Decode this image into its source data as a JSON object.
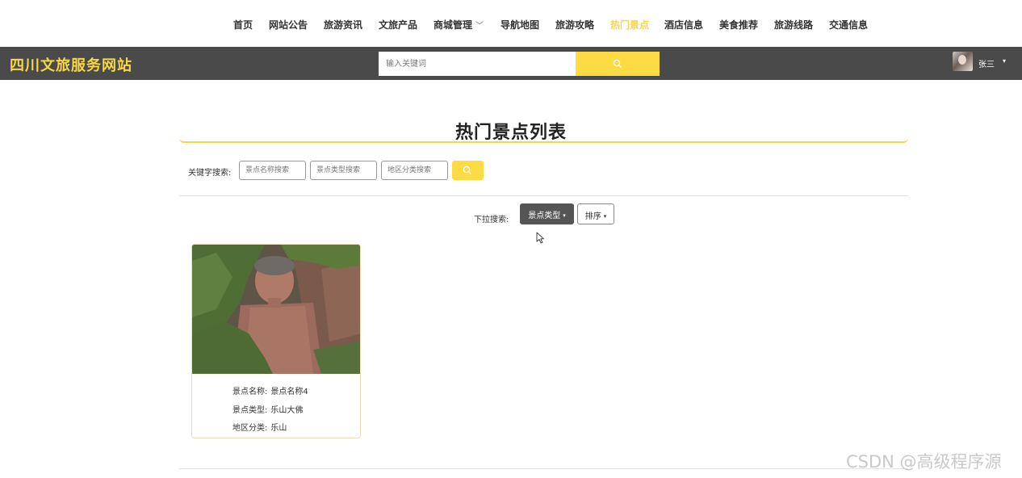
{
  "nav": {
    "items": [
      "首页",
      "网站公告",
      "旅游资讯",
      "文旅产品",
      "商城管理",
      "导航地图",
      "旅游攻略",
      "热门景点",
      "酒店信息",
      "美食推荐",
      "旅游线路",
      "交通信息"
    ],
    "dropdown_chevron": "﹀",
    "active_index": 7
  },
  "header": {
    "brand": "四川文旅服务网站",
    "search_placeholder": "输入关键词",
    "user_name": "张三",
    "user_caret": "▾"
  },
  "page": {
    "title": "热门景点列表",
    "keyword_search_label": "关键字搜索:",
    "placeholders": [
      "景点名称搜索",
      "景点类型搜索",
      "地区分类搜索"
    ],
    "dropdown_search_label": "下拉搜索:",
    "dropdown_type_label": "景点类型",
    "dropdown_sort_label": "排序",
    "caret": "▾"
  },
  "cards": [
    {
      "name_key": "景点名称:",
      "name_value": "景点名称4",
      "type_key": "景点类型:",
      "type_value": "乐山大佛",
      "region_key": "地区分类:",
      "region_value": "乐山"
    }
  ],
  "watermark": "CSDN @高级程序源",
  "colors": {
    "accent": "#f7d648",
    "button_yellow": "#fedb45",
    "header_bg": "#4a4a4a",
    "dropdown_active_bg": "#555555"
  }
}
